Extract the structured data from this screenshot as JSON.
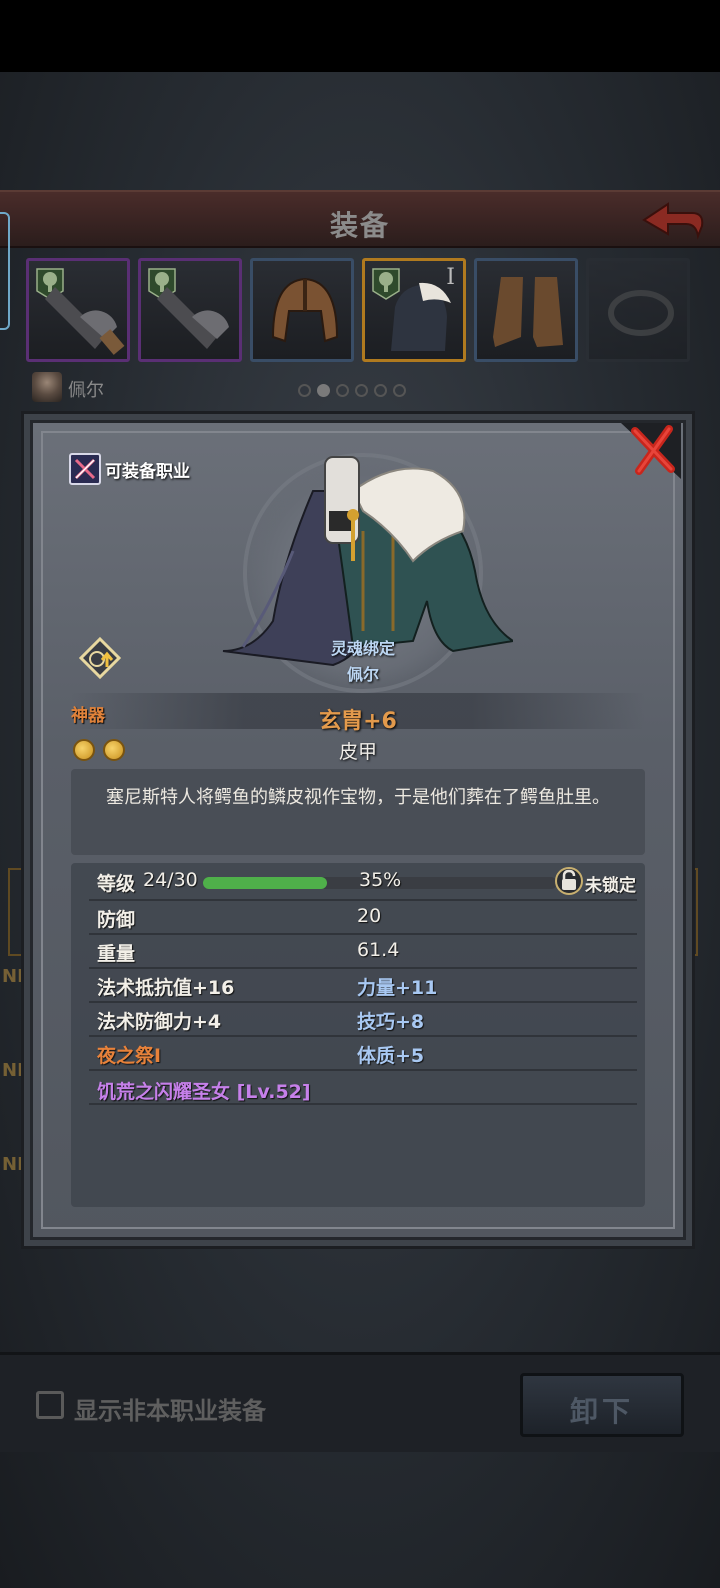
{
  "header": {
    "title": "装备"
  },
  "character": {
    "name": "佩尔",
    "page_dots": 6,
    "active_dot": 1
  },
  "slots": [
    {
      "name": "weapon-slot-1",
      "rarity": "purple"
    },
    {
      "name": "weapon-slot-2",
      "rarity": "purple"
    },
    {
      "name": "helmet-slot",
      "rarity": "blue"
    },
    {
      "name": "armor-slot",
      "rarity": "gold",
      "level_mark": "I"
    },
    {
      "name": "boots-slot",
      "rarity": "blue"
    },
    {
      "name": "ring-slot",
      "rarity": "grey"
    }
  ],
  "side_labels": {
    "ne": "NE"
  },
  "modal": {
    "class_label": "可装备职业",
    "soulbound_label": "灵魂绑定",
    "soulbound_owner": "佩尔",
    "artifact_label": "神器",
    "item_name": "玄胄+6",
    "item_type": "皮甲",
    "description": "塞尼斯特人将鳄鱼的鳞皮视作宝物，于是他们葬在了鳄鱼肚里。",
    "level": {
      "label": "等级",
      "value": "24/30",
      "percent_text": "35%",
      "progress": 0.35,
      "lock_text": "未锁定"
    },
    "stats_left": [
      {
        "label": "防御",
        "value": "20"
      },
      {
        "label": "重量",
        "value": "61.4"
      }
    ],
    "bonuses_left": [
      "法术抵抗值+16",
      "法术防御力+4"
    ],
    "bonuses_right": [
      "力量+11",
      "技巧+8",
      "体质+5"
    ],
    "special": "夜之祭I",
    "set": "饥荒之闪耀圣女 [Lv.52]"
  },
  "bottom": {
    "checkbox_label": "显示非本职业装备",
    "unequip_label": "卸下"
  },
  "colors": {
    "rarity_purple": "#5a2f74",
    "rarity_gold": "#b07a1f",
    "xp_green": "#4fb04a",
    "item_name": "#e39a4c",
    "set_purple": "#c680ea"
  }
}
